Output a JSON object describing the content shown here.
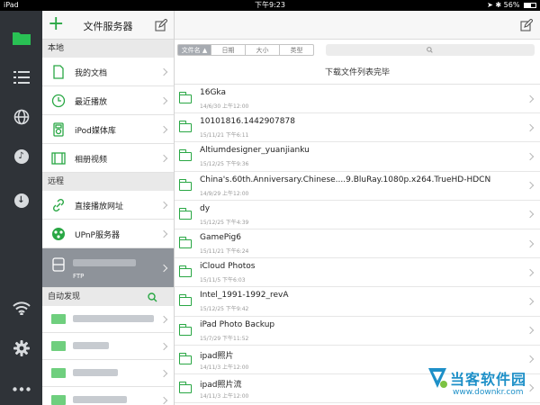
{
  "status": {
    "device": "iPad",
    "time": "下午9:23",
    "battery": "56%",
    "battery_level": 0.56
  },
  "sidebar": {
    "title": "文件服务器",
    "local_section": "本地",
    "local_items": [
      {
        "label": "我的文档",
        "icon": "document-icon"
      },
      {
        "label": "最近播放",
        "icon": "clock-icon"
      },
      {
        "label": "iPod媒体库",
        "icon": "ipod-icon"
      },
      {
        "label": "相册视频",
        "icon": "film-icon"
      }
    ],
    "remote_section": "远程",
    "remote_items": [
      {
        "label": "直接播放网址",
        "icon": "link-icon"
      },
      {
        "label": "UPnP服务器",
        "icon": "upnp-icon"
      }
    ],
    "ftp_label": "FTP",
    "discover_section": "自动发现"
  },
  "main": {
    "sort_tabs": [
      "文件名 ▲",
      "日期",
      "大小",
      "类型"
    ],
    "message": "下载文件列表完毕",
    "files": [
      {
        "name": "16Gka",
        "date": "14/6/30 上午12:00"
      },
      {
        "name": "10101816.1442907878",
        "date": "15/11/21 下午6:11"
      },
      {
        "name": "Altiumdesigner_yuanjianku",
        "date": "15/12/25 下午9:36"
      },
      {
        "name": "China's.60th.Anniversary.Chinese....9.BluRay.1080p.x264.TrueHD-HDCN",
        "date": "14/9/29 上午12:00"
      },
      {
        "name": "dy",
        "date": "15/12/25 下午4:39"
      },
      {
        "name": "GamePig6",
        "date": "15/11/21 下午6:24"
      },
      {
        "name": "iCloud Photos",
        "date": "15/11/5 下午6:03"
      },
      {
        "name": "Intel_1991-1992_revA",
        "date": "15/12/25 下午9:42"
      },
      {
        "name": "iPad Photo Backup",
        "date": "15/7/29 下午11:52"
      },
      {
        "name": "ipad照片",
        "date": "14/11/3 上午12:00"
      },
      {
        "name": "ipad照片流",
        "date": "14/11/3 上午12:00"
      }
    ]
  },
  "watermark": {
    "brand": "当客软件园",
    "url": "www.downkr.com"
  },
  "colors": {
    "accent": "#29a744",
    "rail": "#2f3338",
    "watermark": "#1e90c8"
  }
}
